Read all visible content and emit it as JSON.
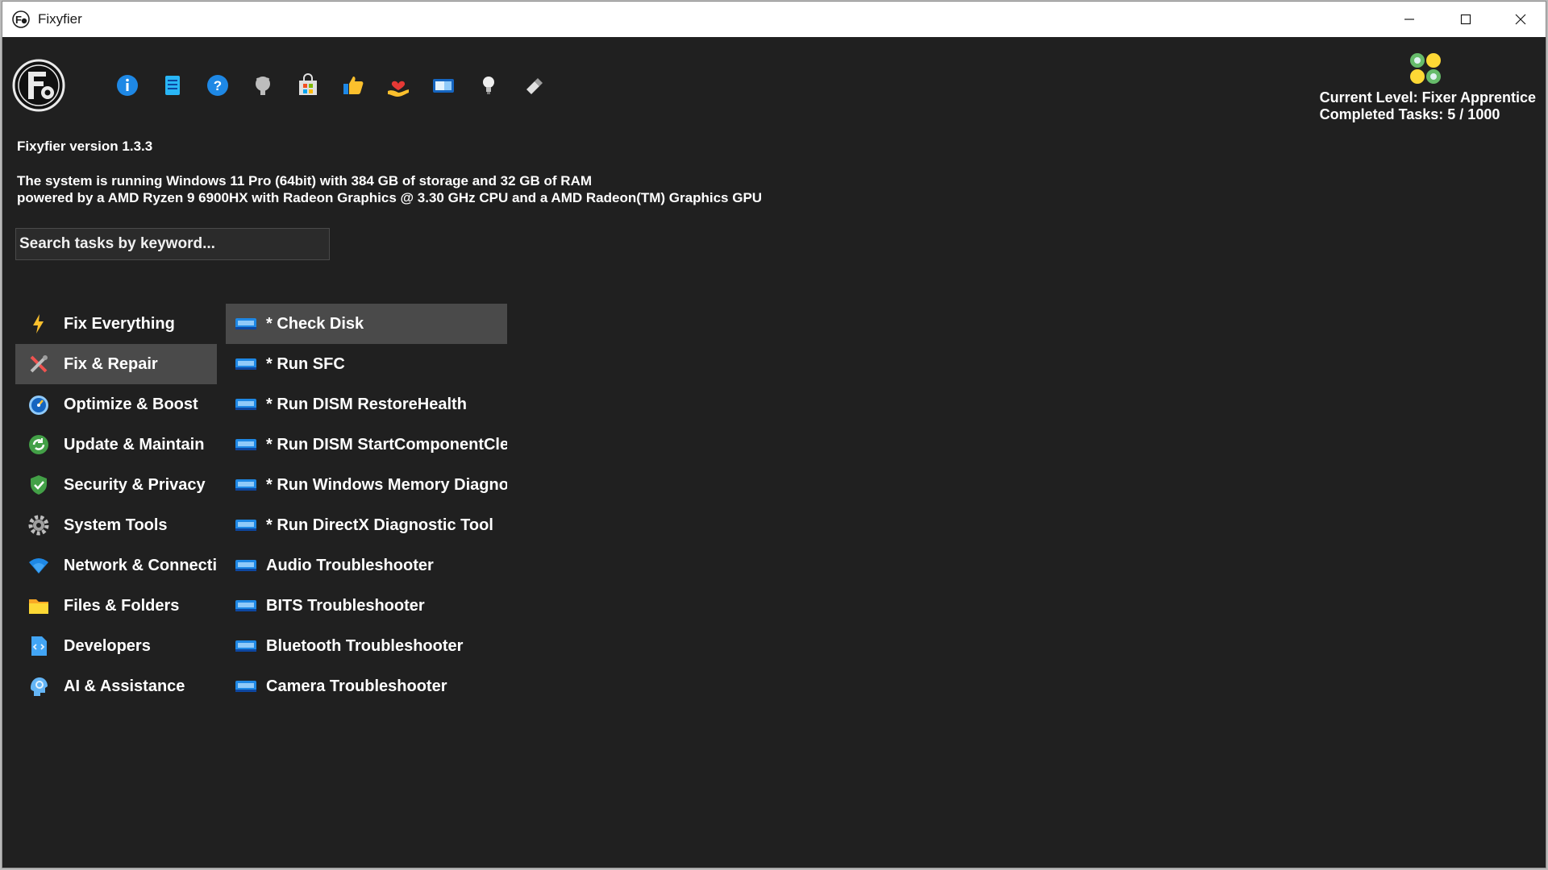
{
  "window": {
    "title": "Fixyfier",
    "controls": [
      "minimize",
      "maximize",
      "close"
    ]
  },
  "toolbar": {
    "icons": [
      "info-icon",
      "notes-icon",
      "help-icon",
      "github-icon",
      "store-icon",
      "thumbs-up-icon",
      "donate-heart-icon",
      "screen-icon",
      "lightbulb-icon",
      "eraser-icon"
    ]
  },
  "level": {
    "current": "Current Level: Fixer Apprentice",
    "completed": "Completed Tasks: 5 / 1000"
  },
  "version": "Fixyfier version 1.3.3",
  "system_info": {
    "line1": "The system is running Windows 11 Pro (64bit) with 384 GB of storage and 32 GB of RAM",
    "line2": "powered by a AMD Ryzen 9 6900HX with Radeon Graphics @ 3.30 GHz CPU and a AMD Radeon(TM) Graphics GPU"
  },
  "search": {
    "placeholder": "Search tasks by keyword...",
    "value": ""
  },
  "categories": [
    {
      "label": "Fix Everything",
      "icon": "lightning-icon"
    },
    {
      "label": "Fix & Repair",
      "icon": "tools-icon",
      "selected": true
    },
    {
      "label": "Optimize & Boost",
      "icon": "speedometer-icon"
    },
    {
      "label": "Update & Maintain",
      "icon": "refresh-icon"
    },
    {
      "label": "Security & Privacy",
      "icon": "shield-icon"
    },
    {
      "label": "System Tools",
      "icon": "gear-icon"
    },
    {
      "label": "Network & Connectivity",
      "icon": "wifi-icon"
    },
    {
      "label": "Files & Folders",
      "icon": "folder-icon"
    },
    {
      "label": "Developers",
      "icon": "code-icon"
    },
    {
      "label": "AI & Assistance",
      "icon": "ai-head-icon"
    }
  ],
  "tasks": [
    {
      "label": "* Check Disk",
      "selected": true
    },
    {
      "label": "* Run SFC"
    },
    {
      "label": "* Run DISM RestoreHealth"
    },
    {
      "label": "* Run DISM StartComponentCleanup"
    },
    {
      "label": "* Run Windows Memory Diagnostic"
    },
    {
      "label": "* Run DirectX Diagnostic Tool"
    },
    {
      "label": "Audio Troubleshooter"
    },
    {
      "label": "BITS Troubleshooter"
    },
    {
      "label": "Bluetooth Troubleshooter"
    },
    {
      "label": "Camera Troubleshooter"
    }
  ]
}
